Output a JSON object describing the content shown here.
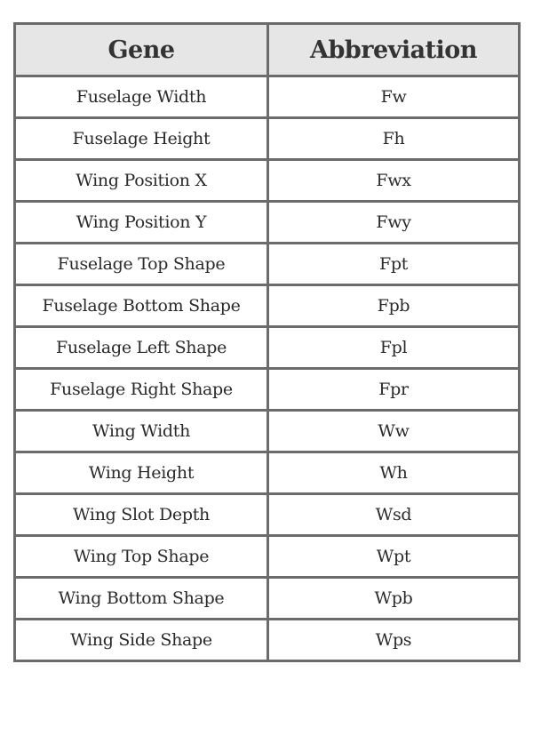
{
  "table": {
    "headers": [
      "Gene",
      "Abbreviation"
    ],
    "rows": [
      {
        "gene": "Fuselage Width",
        "abbreviation": "Fw"
      },
      {
        "gene": "Fuselage Height",
        "abbreviation": "Fh"
      },
      {
        "gene": "Wing Position X",
        "abbreviation": "Fwx"
      },
      {
        "gene": "Wing Position Y",
        "abbreviation": "Fwy"
      },
      {
        "gene": "Fuselage Top Shape",
        "abbreviation": "Fpt"
      },
      {
        "gene": "Fuselage Bottom Shape",
        "abbreviation": "Fpb"
      },
      {
        "gene": "Fuselage Left Shape",
        "abbreviation": "Fpl"
      },
      {
        "gene": "Fuselage Right Shape",
        "abbreviation": "Fpr"
      },
      {
        "gene": "Wing Width",
        "abbreviation": "Ww"
      },
      {
        "gene": "Wing Height",
        "abbreviation": "Wh"
      },
      {
        "gene": "Wing Slot Depth",
        "abbreviation": "Wsd"
      },
      {
        "gene": "Wing Top Shape",
        "abbreviation": "Wpt"
      },
      {
        "gene": "Wing Bottom Shape",
        "abbreviation": "Wpb"
      },
      {
        "gene": "Wing Side Shape",
        "abbreviation": "Wps"
      }
    ]
  },
  "colors": {
    "border": "#6b6b6b",
    "header_background": "#e6e6e6",
    "text": "#2a2a2a"
  }
}
